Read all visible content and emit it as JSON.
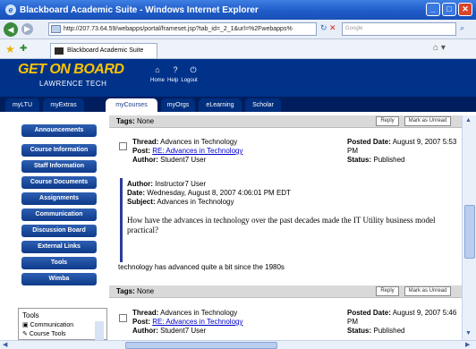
{
  "window": {
    "title": "Blackboard Academic Suite - Windows Internet Explorer",
    "controls": [
      "_",
      "□",
      "✕"
    ]
  },
  "browser": {
    "url": "http://207.73.64.59/webapps/portal/frameset.jsp?tab_id=_2_1&url=%2Fwebapps%",
    "search_placeholder": "Google",
    "tab_title": "Blackboard Academic Suite"
  },
  "header": {
    "logo_line1": "GET ON BOARD",
    "logo_line2": "LAWRENCE TECH",
    "links": [
      "Home",
      "Help",
      "Logout"
    ]
  },
  "nav_tabs": [
    {
      "label": "myLTU"
    },
    {
      "label": "myExtras"
    },
    {
      "label": "myCourses"
    },
    {
      "label": "myOrgs"
    },
    {
      "label": "eLearning"
    },
    {
      "label": "Scholar"
    }
  ],
  "course_menu": [
    "Announcements",
    "Course Information",
    "Staff Information",
    "Course Documents",
    "Assignments",
    "Communication",
    "Discussion Board",
    "External Links",
    "Tools",
    "Wimba"
  ],
  "tools_panel": {
    "title": "Tools",
    "items": [
      "Communication",
      "Course Tools"
    ]
  },
  "post_actions": {
    "reply": "Reply",
    "mark_unread": "Mark as Unread"
  },
  "tags_label": "Tags:",
  "tags_value": "None",
  "labels": {
    "thread": "Thread:",
    "post": "Post:",
    "author": "Author:",
    "posted_date": "Posted Date:",
    "status": "Status:",
    "date": "Date:",
    "subject": "Subject:"
  },
  "post1": {
    "thread": "Advances in Technology",
    "post": "RE: Advances in Technology",
    "author": "Student7 User",
    "posted_date": "August 9, 2007 5:53",
    "posted_date_cont": "PM",
    "status": "Published"
  },
  "quote": {
    "author": "Instructor7 User",
    "date": "Wednesday, August 8, 2007 4:06:01 PM EDT",
    "subject": "Advances in Technology",
    "body_line1": "How have the advances in technology over the past decades made the IT Utility business model",
    "body_line2": "practical?"
  },
  "reply_text": "technology has advanced quite a bit since the 1980s",
  "post2": {
    "thread": "Advances in Technology",
    "post": "RE: Advances in Technology",
    "author": "Student7 User",
    "posted_date": "August 9, 2007 5:46",
    "posted_date_cont": "PM",
    "status": "Published"
  }
}
